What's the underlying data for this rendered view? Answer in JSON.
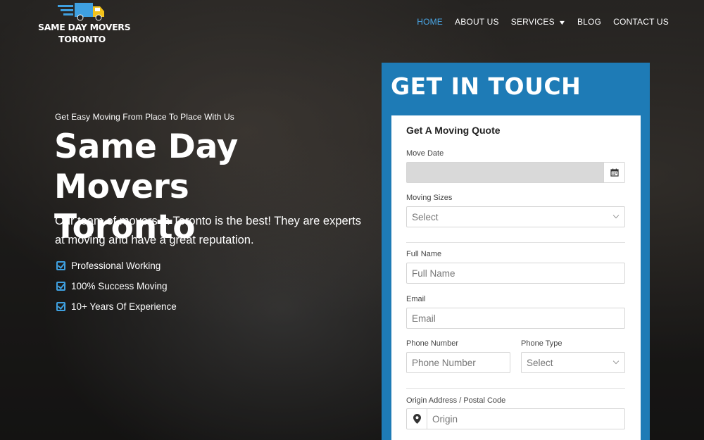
{
  "header": {
    "logo_line1": "SAME DAY MOVERS",
    "logo_line2": "TORONTO",
    "nav": [
      {
        "label": "HOME",
        "active": true
      },
      {
        "label": "ABOUT US"
      },
      {
        "label": "SERVICES",
        "has_dropdown": true
      },
      {
        "label": "BLOG"
      },
      {
        "label": "CONTACT US"
      }
    ]
  },
  "hero": {
    "tagline": "Get Easy Moving From Place To Place With Us",
    "title_line1": "Same Day Movers",
    "title_line2": "Toronto",
    "description": "Our team of movers in Toronto is the best! They are experts at moving and have a great reputation.",
    "features": [
      "Professional Working",
      "100% Success Moving",
      "10+ Years Of Experience"
    ]
  },
  "contact": {
    "title": "GET IN TOUCH",
    "form_title": "Get A Moving Quote",
    "move_date_label": "Move Date",
    "move_date_value": "",
    "moving_sizes_label": "Moving Sizes",
    "moving_sizes_value": "Select",
    "full_name_label": "Full Name",
    "full_name_placeholder": "Full Name",
    "email_label": "Email",
    "email_placeholder": "Email",
    "phone_number_label": "Phone Number",
    "phone_number_placeholder": "Phone Number",
    "phone_type_label": "Phone Type",
    "phone_type_value": "Select",
    "origin_label": "Origin Address / Postal Code",
    "origin_placeholder": "Origin"
  },
  "colors": {
    "accent": "#1e7bb6",
    "nav_active": "#4aa7e6",
    "check": "#3fa0e0",
    "logo_truck": "#f2c21b"
  }
}
